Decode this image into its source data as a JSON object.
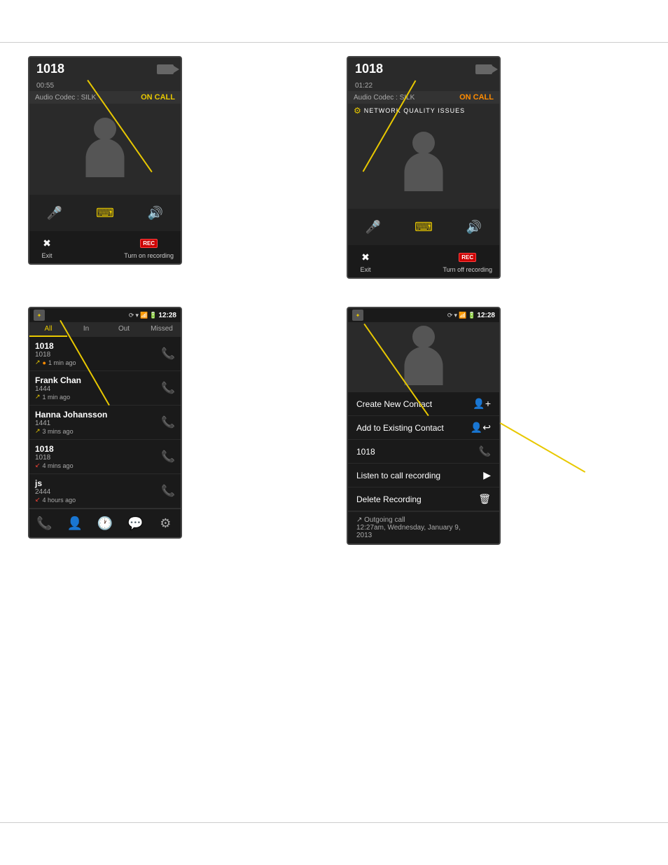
{
  "page": {
    "background": "#ffffff"
  },
  "screen1": {
    "number": "1018",
    "timer": "00:55",
    "codec": "Audio Codec : SILK",
    "status": "ON CALL",
    "exit_label": "Exit",
    "rec_label": "Turn on recording"
  },
  "screen2": {
    "number": "1018",
    "timer": "01:22",
    "codec": "Audio Codec : SILK",
    "status": "ON CALL",
    "network_issue": "NETWORK QUALITY ISSUES",
    "exit_label": "Exit",
    "rec_label": "Turn off recording"
  },
  "screen3": {
    "time": "12:28",
    "tabs": [
      "All",
      "In",
      "Out",
      "Missed"
    ],
    "entries": [
      {
        "name": "1018",
        "number": "1018",
        "time": "1 min ago",
        "direction": "out_missed"
      },
      {
        "name": "Frank Chan",
        "number": "1444",
        "time": "1 min ago",
        "direction": "out"
      },
      {
        "name": "Hanna Johansson",
        "number": "1441",
        "time": "3 mins ago",
        "direction": "out"
      },
      {
        "name": "1018",
        "number": "1018",
        "time": "4 mins ago",
        "direction": "in_missed"
      },
      {
        "name": "js",
        "number": "2444",
        "time": "4 hours ago",
        "direction": "in_missed"
      }
    ]
  },
  "screen4": {
    "time": "12:28",
    "menu_items": [
      {
        "label": "Create New Contact",
        "icon": "person-add"
      },
      {
        "label": "Add to Existing Contact",
        "icon": "person-add"
      },
      {
        "label": "1018",
        "icon": "phone"
      },
      {
        "label": "Listen to call recording",
        "icon": "play"
      },
      {
        "label": "Delete Recording",
        "icon": "trash"
      }
    ],
    "footer": {
      "line1": "↗ Outgoing call",
      "line2": "12:27am, Wednesday, January 9,",
      "line3": "2013"
    }
  }
}
